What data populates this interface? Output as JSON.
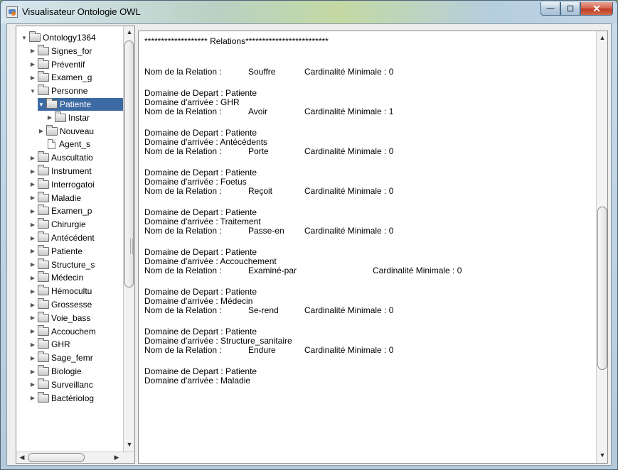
{
  "window": {
    "title": "Visualisateur Ontologie OWL",
    "minimize_glyph": "—",
    "maximize_glyph": "☐",
    "close_glyph": "✕"
  },
  "tree": {
    "items": [
      {
        "label": "Ontology1364",
        "level": 0,
        "expanded": true,
        "type": "folder"
      },
      {
        "label": "Signes_for",
        "level": 1,
        "expanded": false,
        "type": "folder"
      },
      {
        "label": "Préventif",
        "level": 1,
        "expanded": false,
        "type": "folder"
      },
      {
        "label": "Examen_g",
        "level": 1,
        "expanded": false,
        "type": "folder"
      },
      {
        "label": "Personne",
        "level": 1,
        "expanded": true,
        "type": "folder"
      },
      {
        "label": "Patiente",
        "level": 2,
        "expanded": true,
        "type": "folder",
        "selected": true
      },
      {
        "label": "Instar",
        "level": 3,
        "expanded": false,
        "type": "folder"
      },
      {
        "label": "Nouveau",
        "level": 2,
        "expanded": false,
        "type": "folder"
      },
      {
        "label": "Agent_s",
        "level": 2,
        "expanded": null,
        "type": "file"
      },
      {
        "label": "Auscultatio",
        "level": 1,
        "expanded": false,
        "type": "folder"
      },
      {
        "label": "Instrument",
        "level": 1,
        "expanded": false,
        "type": "folder"
      },
      {
        "label": "Interrogatoi",
        "level": 1,
        "expanded": false,
        "type": "folder"
      },
      {
        "label": "Maladie",
        "level": 1,
        "expanded": false,
        "type": "folder"
      },
      {
        "label": "Examen_p",
        "level": 1,
        "expanded": false,
        "type": "folder"
      },
      {
        "label": "Chirurgie",
        "level": 1,
        "expanded": false,
        "type": "folder"
      },
      {
        "label": "Antécédent",
        "level": 1,
        "expanded": false,
        "type": "folder"
      },
      {
        "label": "Patiente",
        "level": 1,
        "expanded": false,
        "type": "folder"
      },
      {
        "label": "Structure_s",
        "level": 1,
        "expanded": false,
        "type": "folder"
      },
      {
        "label": "Médecin",
        "level": 1,
        "expanded": false,
        "type": "folder"
      },
      {
        "label": "Hémocultu",
        "level": 1,
        "expanded": false,
        "type": "folder"
      },
      {
        "label": "Grossesse",
        "level": 1,
        "expanded": false,
        "type": "folder"
      },
      {
        "label": "Voie_bass",
        "level": 1,
        "expanded": false,
        "type": "folder"
      },
      {
        "label": "Accouchem",
        "level": 1,
        "expanded": false,
        "type": "folder"
      },
      {
        "label": "GHR",
        "level": 1,
        "expanded": false,
        "type": "folder"
      },
      {
        "label": "Sage_femr",
        "level": 1,
        "expanded": false,
        "type": "folder"
      },
      {
        "label": "Biologie",
        "level": 1,
        "expanded": false,
        "type": "folder"
      },
      {
        "label": "Surveillanc",
        "level": 1,
        "expanded": false,
        "type": "folder"
      },
      {
        "label": "Bactériolog",
        "level": 1,
        "expanded": false,
        "type": "folder"
      }
    ]
  },
  "relations": {
    "header": "******************* Relations*************************",
    "first": {
      "name_label": "Nom de la Relation :",
      "name": "Souffre",
      "card_label": "Cardinalité Minimale : 0"
    },
    "blocks": [
      {
        "domaine_depart": "Domaine de Depart : Patiente",
        "domaine_arrivee": "Domaine d'arrivée : GHR",
        "name_label": "Nom de la Relation :",
        "name": "Avoir",
        "card_label": "Cardinalité Minimale : 1",
        "far": false
      },
      {
        "domaine_depart": "Domaine de Depart : Patiente",
        "domaine_arrivee": "Domaine d'arrivée : Antécédents",
        "name_label": "Nom de la Relation :",
        "name": "Porte",
        "card_label": "Cardinalité Minimale : 0",
        "far": false
      },
      {
        "domaine_depart": "Domaine de Depart : Patiente",
        "domaine_arrivee": "Domaine d'arrivée : Foetus",
        "name_label": "Nom de la Relation :",
        "name": "Reçoit",
        "card_label": "Cardinalité Minimale : 0",
        "far": false
      },
      {
        "domaine_depart": "Domaine de Depart : Patiente",
        "domaine_arrivee": "Domaine d'arrivée : Traitement",
        "name_label": "Nom de la Relation :",
        "name": "Passe-en",
        "card_label": "Cardinalité Minimale : 0",
        "far": false
      },
      {
        "domaine_depart": "Domaine de Depart : Patiente",
        "domaine_arrivee": "Domaine d'arrivée : Accouchement",
        "name_label": "Nom de la Relation :",
        "name": "Examiné-par",
        "card_label": "Cardinalité Minimale : 0",
        "far": true
      },
      {
        "domaine_depart": "Domaine de Depart : Patiente",
        "domaine_arrivee": "Domaine d'arrivée : Médecin",
        "name_label": "Nom de la Relation :",
        "name": "Se-rend",
        "card_label": "Cardinalité Minimale : 0",
        "far": false
      },
      {
        "domaine_depart": "Domaine de Depart : Patiente",
        "domaine_arrivee": "Domaine d'arrivée : Structure_sanitaire",
        "name_label": "Nom de la Relation :",
        "name": "Endure",
        "card_label": "Cardinalité Minimale : 0",
        "far": false
      },
      {
        "domaine_depart": "Domaine de Depart : Patiente",
        "domaine_arrivee": "Domaine d'arrivée : Maladie"
      }
    ]
  },
  "icons": {
    "app": "java-app-icon",
    "tree_folder": "folder-icon",
    "tree_file": "file-icon",
    "expand": "triangle-right-icon",
    "collapse": "triangle-down-icon"
  },
  "colors": {
    "selection": "#3d6aa3",
    "panel_bg": "#ffffff",
    "window_bg": "#eeeeee"
  }
}
